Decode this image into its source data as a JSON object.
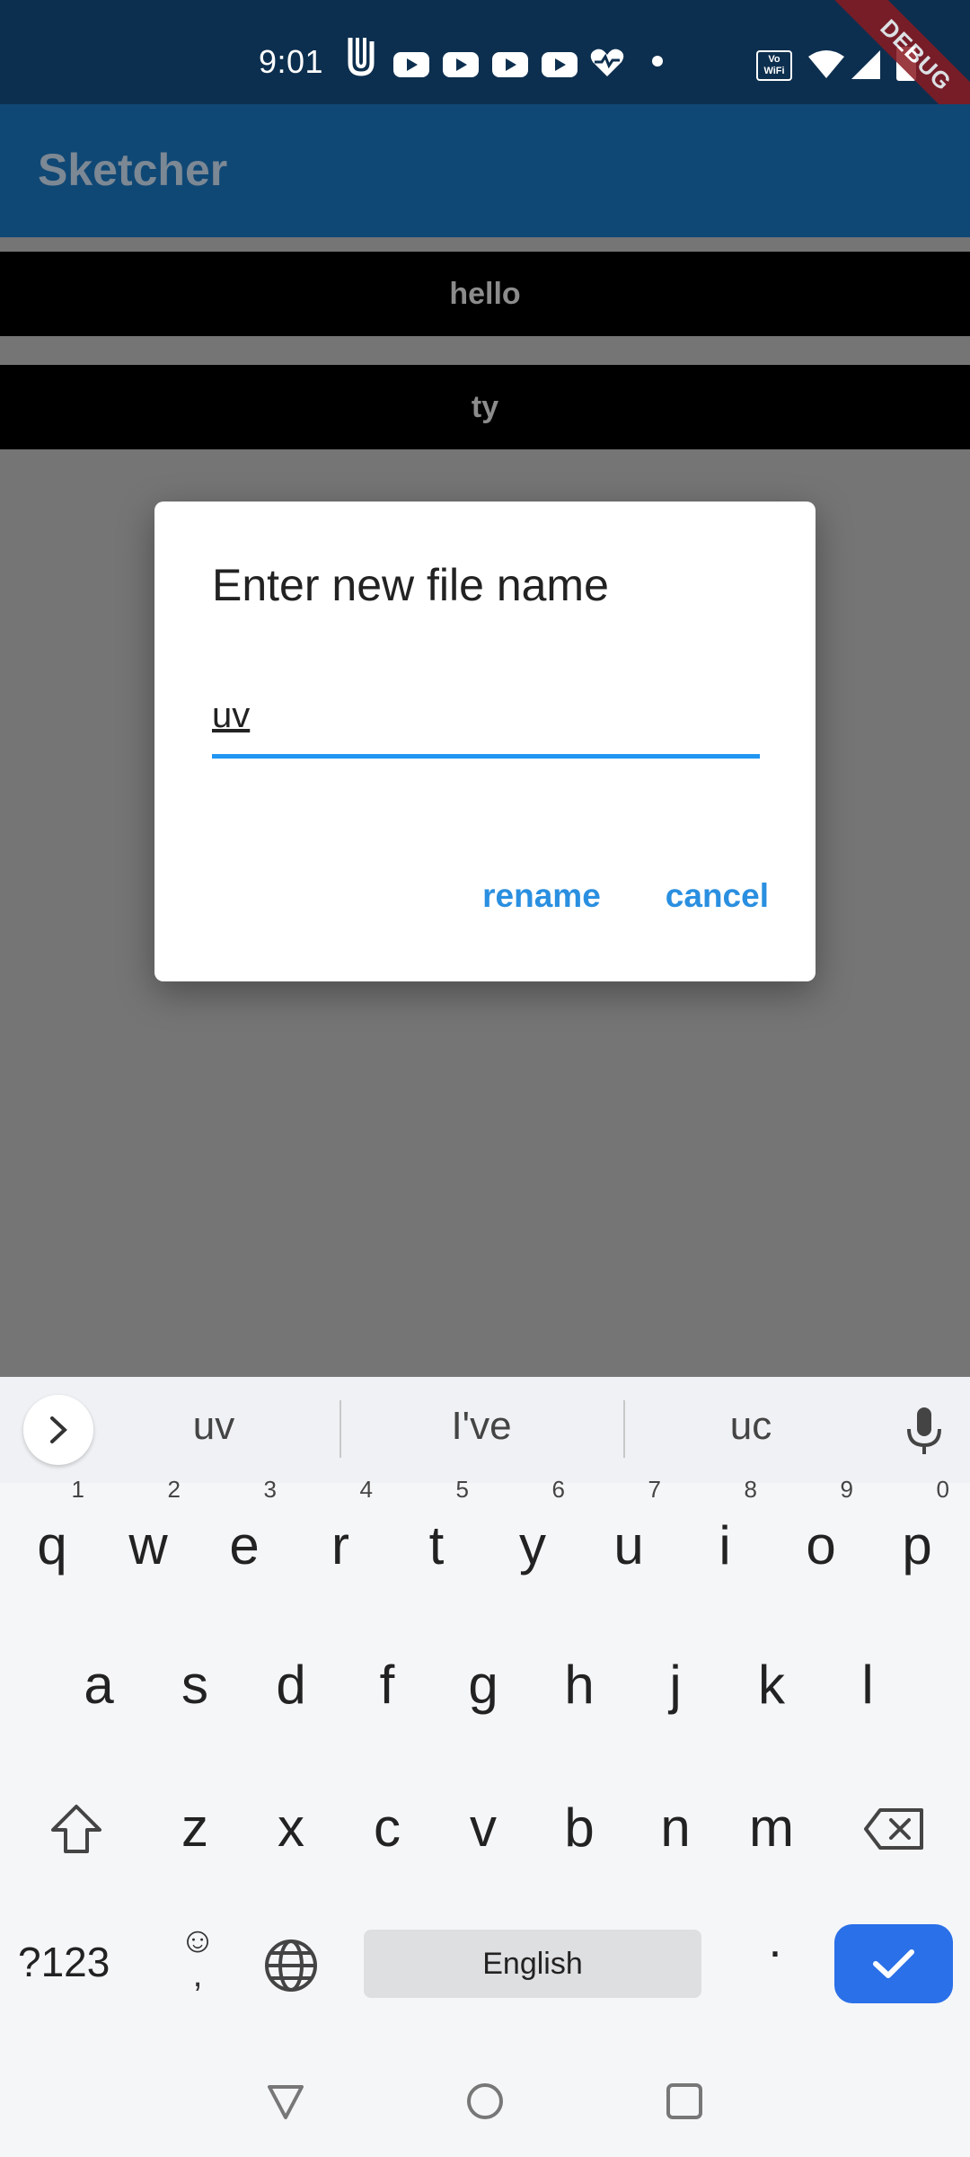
{
  "status_bar": {
    "time": "9:01",
    "debug_label": "DEBUG",
    "wifi_label": "Vo WiFi"
  },
  "app_bar": {
    "title": "Sketcher"
  },
  "files": [
    {
      "name": "hello"
    },
    {
      "name": "ty"
    }
  ],
  "dialog": {
    "title": "Enter new file name",
    "input_value": "uv",
    "rename_label": "rename",
    "cancel_label": "cancel"
  },
  "keyboard": {
    "suggestions": [
      "uv",
      "I've",
      "uc"
    ],
    "row1": [
      "q",
      "w",
      "e",
      "r",
      "t",
      "y",
      "u",
      "i",
      "o",
      "p"
    ],
    "row1_numbers": [
      "1",
      "2",
      "3",
      "4",
      "5",
      "6",
      "7",
      "8",
      "9",
      "0"
    ],
    "row2": [
      "a",
      "s",
      "d",
      "f",
      "g",
      "h",
      "j",
      "k",
      "l"
    ],
    "row3": [
      "z",
      "x",
      "c",
      "v",
      "b",
      "n",
      "m"
    ],
    "symbols_label": "?123",
    "comma_label": ",",
    "space_label": "English",
    "period_label": "."
  },
  "colors": {
    "accent": "#2196f3",
    "app_bar": "#104875",
    "status_bar": "#0d2f4f",
    "enter_key": "#2a70e8"
  }
}
